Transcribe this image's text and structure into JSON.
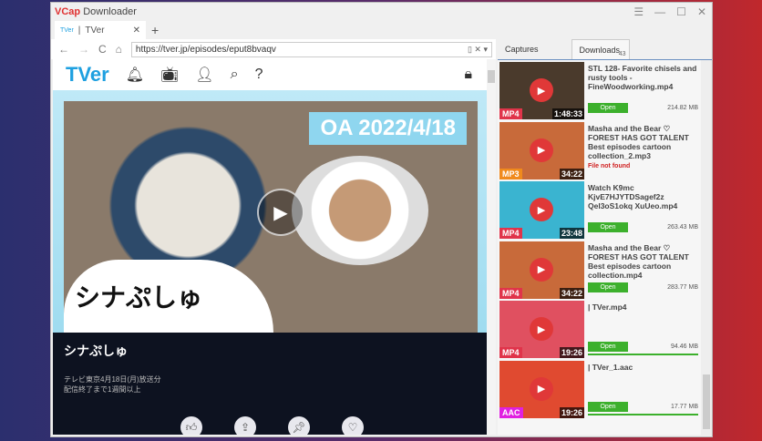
{
  "app": {
    "title_brand": "VCap",
    "title_rest": "Downloader",
    "window_controls": [
      "menu-icon",
      "minimize-icon",
      "maximize-icon",
      "close-icon"
    ]
  },
  "browser": {
    "tab_label": "TVer",
    "tab_favicon": "TVer",
    "url": "https://tver.jp/episodes/eput8bvaqv"
  },
  "site": {
    "logo": "TVer",
    "hero_badge": "OA 2022/4/18",
    "show_title_art": "シナぷしゅ",
    "show_title": "シナぷしゅ",
    "info_line1": "テレビ東京4月18日(月)放送分",
    "info_line2": "配信終了まで1週間以上"
  },
  "panel": {
    "tabs": [
      "Captures",
      "Downloads"
    ],
    "downloads_count": "43",
    "items": [
      {
        "name": "STL 128- Favorite chisels and rusty tools - FineWoodworking.mp4",
        "format": "MP4",
        "duration": "1:48:33",
        "status": "Open",
        "size": "214.82 MB",
        "format_color": "#e0344a",
        "thumb_color": "#4a3a2c"
      },
      {
        "name": "Masha and the Bear ♡ FOREST HAS GOT TALENT Best episodes cartoon collection_2.mp3",
        "format": "MP3",
        "duration": "34:22",
        "status": "File not found",
        "size": "",
        "format_color": "#f08a1c",
        "thumb_color": "#c86a3a"
      },
      {
        "name": "Watch K9mc KjvE7HJYTDSagef2z Qel3oS1okq XuUeo.mp4",
        "format": "MP4",
        "duration": "23:48",
        "status": "Open",
        "size": "263.43 MB",
        "format_color": "#e0344a",
        "thumb_color": "#3ab4d0"
      },
      {
        "name": "Masha and the Bear ♡ FOREST HAS GOT TALENT Best episodes cartoon collection.mp4",
        "format": "MP4",
        "duration": "34:22",
        "status": "Open",
        "size": "283.77 MB",
        "format_color": "#e0344a",
        "thumb_color": "#c86a3a"
      },
      {
        "name": "| TVer.mp4",
        "format": "MP4",
        "duration": "19:26",
        "status": "Open",
        "size": "94.46 MB",
        "format_color": "#e0344a",
        "thumb_color": "#e05060"
      },
      {
        "name": "| TVer_1.aac",
        "format": "AAC",
        "duration": "19:26",
        "status": "Open",
        "size": "17.77 MB",
        "format_color": "#e020e0",
        "thumb_color": "#e04a30"
      }
    ]
  }
}
